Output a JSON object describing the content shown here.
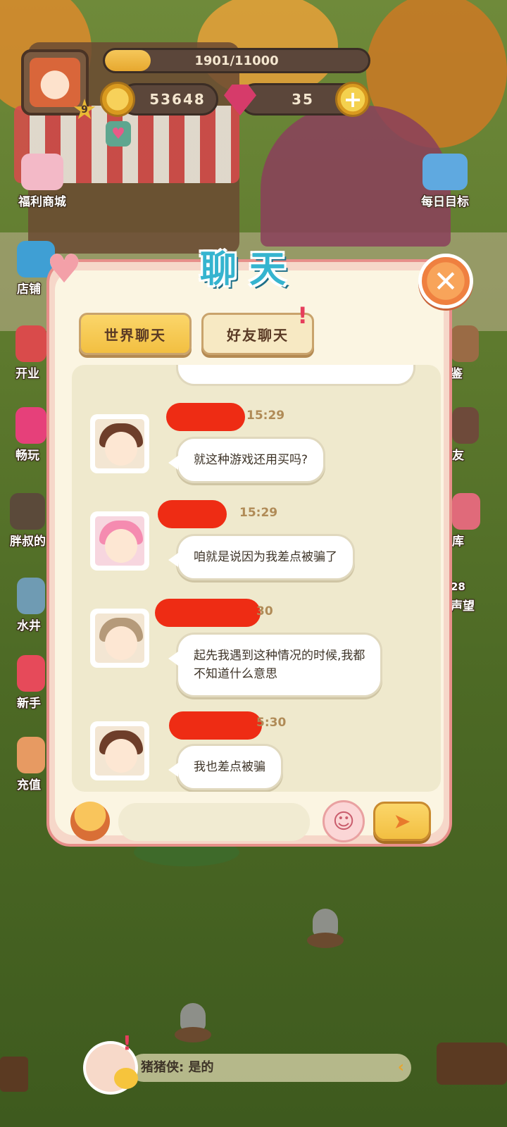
{
  "hud": {
    "level": "9",
    "xp_text": "1901/11000",
    "xp_fraction": 0.173,
    "coins": "53648",
    "gems": "35"
  },
  "side_menu": {
    "left": [
      {
        "label": "福利商城"
      },
      {
        "label": "店铺"
      },
      {
        "label": "开业"
      },
      {
        "label": "畅玩"
      },
      {
        "label": "胖叔的"
      },
      {
        "label": "水井"
      },
      {
        "label": "新手"
      },
      {
        "label": "充值"
      }
    ],
    "right": [
      {
        "label": "每日目标"
      },
      {
        "label": "鉴"
      },
      {
        "label": "友"
      },
      {
        "label": "库"
      },
      {
        "label": "声望"
      },
      {
        "label": "28"
      }
    ]
  },
  "chat": {
    "title": "聊天",
    "tabs": [
      {
        "label": "世界聊天",
        "active": true
      },
      {
        "label": "好友聊天",
        "active": false,
        "alert": "!"
      }
    ],
    "messages": [
      {
        "time": "15:29",
        "text": "就这种游戏还用买吗?"
      },
      {
        "time": "15:29",
        "text": "咱就是说因为我差点被骗了"
      },
      {
        "time": "30",
        "text": "起先我遇到这种情况的时候,我都\n不知道什么意思"
      },
      {
        "time": "5:30",
        "text": "我也差点被骗"
      }
    ],
    "input_placeholder": "",
    "close_symbol": "✕",
    "emoji_symbol": "☺",
    "send_symbol": "➤"
  },
  "ticker": {
    "text": "猪猪侠: 是的",
    "alert": "!",
    "arrow": "‹"
  },
  "colors": {
    "title_blue": "#35b4cf",
    "redaction": "#ee2c14",
    "modal_border": "#e78f8a",
    "tab_active": "#f2bf41"
  },
  "icons": {
    "coin": "coin-icon",
    "gem": "gem-icon",
    "plus": "plus-icon",
    "close": "close-icon",
    "emoji": "smiley-icon",
    "send": "paper-plane-icon",
    "cupcake": "cupcake-icon"
  }
}
